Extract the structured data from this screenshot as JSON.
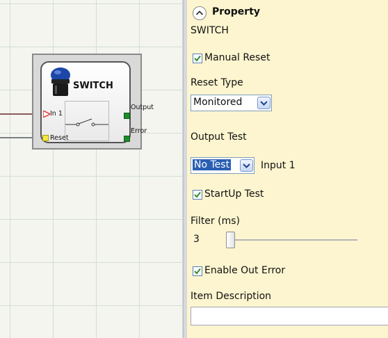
{
  "canvas": {
    "block": {
      "title": "SWITCH",
      "inputs": [
        {
          "label": "In 1"
        },
        {
          "label": "Reset"
        }
      ],
      "outputs": [
        {
          "label": "Output"
        },
        {
          "label": "Error"
        }
      ]
    },
    "colors": {
      "in_port": "#e23b3b",
      "reset_port": "#f2e840",
      "out_port": "#1f8b2c",
      "wire_in1": "#8a5a5a",
      "wire_reset": "#7a7f86"
    }
  },
  "property_panel": {
    "header": "Property",
    "component_name": "SWITCH",
    "manual_reset": {
      "label": "Manual Reset",
      "checked": true
    },
    "reset_type": {
      "label": "Reset Type",
      "value": "Monitored"
    },
    "output_test": {
      "label": "Output Test",
      "value": "No Test",
      "suffix": "Input 1"
    },
    "startup_test": {
      "label": "StartUp Test",
      "checked": true
    },
    "filter": {
      "label": "Filter (ms)",
      "value": "3"
    },
    "enable_out_error": {
      "label": "Enable Out Error",
      "checked": true
    },
    "item_description": {
      "label": "Item Description",
      "value": ""
    },
    "colors": {
      "panel_bg": "#fcf5cf",
      "selection": "#2a5fb3"
    }
  }
}
